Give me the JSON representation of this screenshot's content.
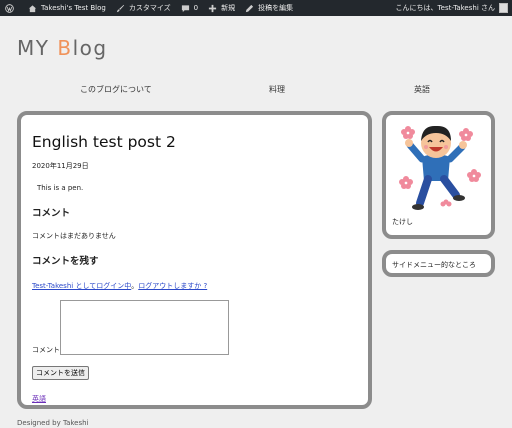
{
  "adminbar": {
    "site_name": "Takeshi's Test Blog",
    "customize": "カスタマイズ",
    "comments_count": "0",
    "new": "新規",
    "edit_post": "投稿を編集",
    "greeting": "こんにちは、Test-Takeshi さん"
  },
  "site": {
    "title_prefix": "MY ",
    "title_b": "B",
    "title_suffix": "log"
  },
  "nav": {
    "items": [
      "このブログについて",
      "料理",
      "英語"
    ]
  },
  "post": {
    "title": "English test post 2",
    "date": "2020年11月29日",
    "body": "This is a pen."
  },
  "comments": {
    "heading": "コメント",
    "none": "コメントはまだありません",
    "reply_heading": "コメントを残す",
    "logged_in_as": "Test-Takeshi としてログイン中",
    "separator": "。",
    "logout": "ログアウトしますか ?",
    "field_label": "コメント",
    "submit": "コメントを送信"
  },
  "category_link": "英語",
  "sidebar": {
    "profile_name": "たけし",
    "menu_text": "サイドメニュー的なところ"
  },
  "footer": "Designed by Takeshi",
  "colors": {
    "adminbar_bg": "#23282d",
    "title_accent": "#f0935a",
    "card_border": "#8c8c8c",
    "link": "#2a48c9",
    "visited_link": "#6b2fb8"
  }
}
